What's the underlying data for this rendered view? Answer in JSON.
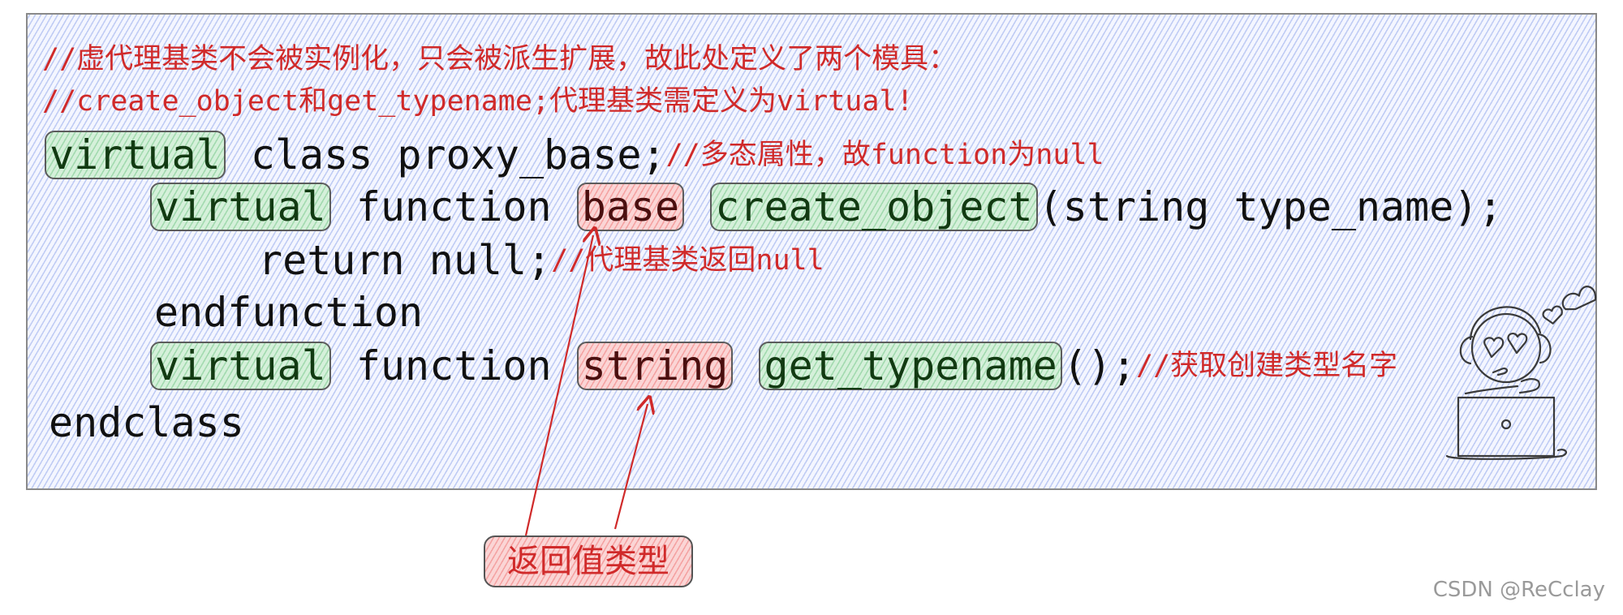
{
  "header_comments": [
    "//虚代理基类不会被实例化，只会被派生扩展，故此处定义了两个模具：",
    "//create_object和get_typename;代理基类需定义为virtual!"
  ],
  "code": {
    "line1": {
      "kw": "virtual",
      "rest": " class proxy_base;",
      "comment": "//多态属性，故function为null"
    },
    "line2": {
      "kw": "virtual",
      "mid": " function ",
      "ret_type": "base",
      "name": "create_object",
      "rest": "(string type_name);"
    },
    "line3": {
      "text": "return null;",
      "comment": "//代理基类返回null"
    },
    "line4": {
      "text": "endfunction"
    },
    "line5": {
      "kw": "virtual",
      "mid": " function ",
      "ret_type": "string",
      "name": "get_typename",
      "rest": "();",
      "comment": "//获取创建类型名字"
    },
    "line6": {
      "text": "endclass"
    }
  },
  "annotation": {
    "label": "返回值类型",
    "points_to": [
      "base",
      "string"
    ]
  },
  "mascot": {
    "icon": "person-at-laptop-with-heart-eyes"
  },
  "watermark": "CSDN @ReCclay",
  "colors": {
    "comment_red": "#d02a2a",
    "highlight_green": "#d5f0da",
    "highlight_red": "#fbd5d5",
    "hatch_blue": "#96aaeb",
    "code_text": "#111111"
  }
}
